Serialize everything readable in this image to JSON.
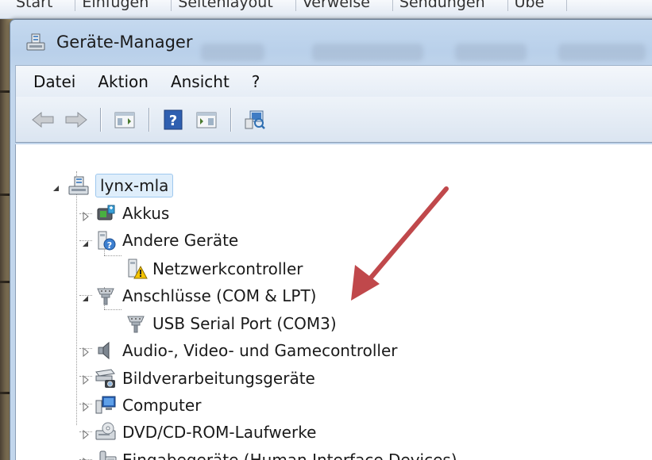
{
  "ribbon": {
    "tabs": [
      "Start",
      "Einfügen",
      "Seitenlayout",
      "Verweise",
      "Sendungen",
      "Übe"
    ]
  },
  "window": {
    "title": "Geräte-Manager",
    "icon": "device-manager-icon"
  },
  "menu": {
    "items": [
      "Datei",
      "Aktion",
      "Ansicht",
      "?"
    ]
  },
  "toolbar": {
    "buttons": [
      "back-arrow-icon",
      "forward-arrow-icon",
      "show-hide-console-tree-icon",
      "help-icon",
      "show-hide-action-pane-icon",
      "scan-hardware-icon"
    ]
  },
  "tree": {
    "root": {
      "label": "lynx-mla",
      "icon": "computer-network-icon",
      "expanded": true,
      "selected": true
    },
    "nodes": [
      {
        "label": "Akkus",
        "icon": "battery-icon",
        "expanded": false,
        "level": 1
      },
      {
        "label": "Andere Geräte",
        "icon": "unknown-device-icon",
        "expanded": true,
        "level": 1
      },
      {
        "label": "Netzwerkcontroller",
        "icon": "warning-device-icon",
        "level": 2
      },
      {
        "label": "Anschlüsse (COM & LPT)",
        "icon": "port-icon",
        "expanded": true,
        "level": 1
      },
      {
        "label": "USB Serial Port (COM3)",
        "icon": "port-icon",
        "level": 2
      },
      {
        "label": "Audio-, Video- und Gamecontroller",
        "icon": "speaker-icon",
        "expanded": false,
        "level": 1
      },
      {
        "label": "Bildverarbeitungsgeräte",
        "icon": "scanner-camera-icon",
        "expanded": false,
        "level": 1
      },
      {
        "label": "Computer",
        "icon": "computer-icon",
        "expanded": false,
        "level": 1
      },
      {
        "label": "DVD/CD-ROM-Laufwerke",
        "icon": "optical-drive-icon",
        "expanded": false,
        "level": 1
      },
      {
        "label": "Eingabegeräte (Human Interface Devices)",
        "icon": "input-device-icon",
        "expanded": false,
        "level": 1
      }
    ]
  },
  "annotation": {
    "arrow_color": "#c0484b",
    "points_to": "USB Serial Port (COM3)"
  }
}
